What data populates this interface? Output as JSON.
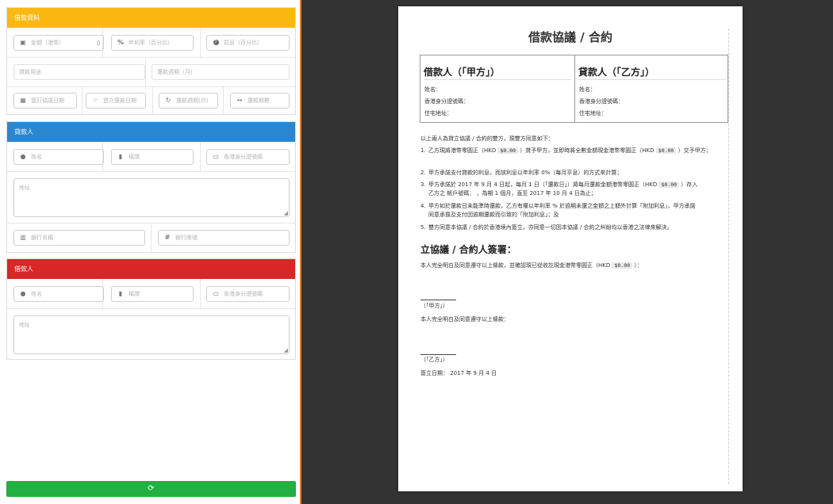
{
  "colors": {
    "loan_header": "#fbb810",
    "lender_header": "#2a87cf",
    "borrower_header": "#d92626",
    "refresh_button": "#22b040",
    "left_border": "#e07a2a",
    "background": "#333333"
  },
  "loan_panel": {
    "title": "借款資料",
    "row1": [
      {
        "icon": "money-icon",
        "glyph": "💵",
        "placeholder": "金額（港幣）",
        "suffix": "$"
      },
      {
        "icon": "percent-icon",
        "glyph": "%",
        "placeholder": "年利率（百分比）"
      },
      {
        "icon": "question-icon",
        "glyph": "?",
        "placeholder": "罰息（百分比）"
      }
    ],
    "row2": [
      {
        "placeholder": "貸款用途"
      },
      {
        "placeholder": "還款週期（月）"
      }
    ],
    "row3": [
      {
        "icon": "calendar-icon",
        "glyph": "📅",
        "placeholder": "簽訂協議日期"
      },
      {
        "icon": "hand-icon",
        "glyph": "☞",
        "placeholder": "首次還款日期"
      },
      {
        "icon": "repeat-icon",
        "glyph": "↻",
        "placeholder": "還款週期(月)"
      },
      {
        "icon": "arrows-icon",
        "glyph": "↔",
        "placeholder": "還款期數"
      }
    ]
  },
  "lender_panel": {
    "title": "貸款人",
    "row1": [
      {
        "icon": "user-icon",
        "glyph": "👤",
        "placeholder": "姓名"
      },
      {
        "icon": "id-badge-icon",
        "glyph": "▮",
        "placeholder": "稱謂"
      },
      {
        "icon": "id-card-icon",
        "glyph": "▭",
        "placeholder": "香港身分證號碼"
      }
    ],
    "address_placeholder": "地址",
    "row3": [
      {
        "icon": "bank-icon",
        "glyph": "🏦",
        "placeholder": "銀行名稱"
      },
      {
        "icon": "hash-icon",
        "glyph": "#",
        "placeholder": "銀行賬號"
      }
    ]
  },
  "borrower_panel": {
    "title": "借款人",
    "row1": [
      {
        "icon": "user-icon",
        "glyph": "👤",
        "placeholder": "姓名"
      },
      {
        "icon": "id-badge-icon",
        "glyph": "▮",
        "placeholder": "稱謂"
      },
      {
        "icon": "id-card-icon",
        "glyph": "▭",
        "placeholder": "香港身分證號碼"
      }
    ],
    "address_placeholder": "地址"
  },
  "refresh_button": {
    "icon": "refresh-icon",
    "glyph": "⟳"
  },
  "document": {
    "title": "借款協議 / 合約",
    "borrower_col": {
      "heading": "借款人（「甲方」）",
      "name_label": "姓名：",
      "id_label": "香港身分證號碼：",
      "address_label": "住宅地址："
    },
    "lender_col": {
      "heading": "貸款人（「乙方」）",
      "name_label": "姓名：",
      "id_label": "香港身分證號碼：",
      "address_label": "住宅地址："
    },
    "intro": "以上兩人為貸立協議 / 合約的雙方，現雙方同意如下：",
    "clauses": [
      {
        "num": "1.",
        "pre": "乙方現將港幣零圓正（HKD",
        "amount": "$0.00",
        "mid": "）貸予甲方，並即時將全數金額現金港幣零圓正（HKD",
        "amount2": "$0.00",
        "post": "）交予甲方；",
        "line2": ""
      },
      {
        "num": "2.",
        "text": "甲方承諾支付貸款的利息，而該利息以年利率 0%（每月平息）的方式來計算；"
      },
      {
        "num": "3.",
        "pre": "甲方承諾於 2017 年 9 月 4 日起，每月 1 日（「還款日」）將每月還款金額港幣零圓正（HKD",
        "amount": "$0.00",
        "post": "）存入",
        "line2": "乙方之    帳戶號碼：    ，為期 1 個月，直至 2017 年 10 月 4 日為止；"
      },
      {
        "num": "4.",
        "text": "甲方如於還款日未能準時還款，乙方有權以年利率 % 於逾期未還之金額之上額外計算「附加利息」，甲方承諾",
        "line2": "同意承擔及支付因逾期還款而引致的「附加利息」；及"
      },
      {
        "num": "5.",
        "text": "雙方同意本協議 / 合約於香港境內簽立，亦同意一切因本協議 / 合約之糾紛均以香港之法律來解決。"
      }
    ],
    "sign_heading": "立協議 / 合約人簽署：",
    "borrower_declaration_pre": "本人完全明白及同意遵守以上條款，並確認現已從收訖現金港幣零圓正（HKD",
    "borrower_declaration_amount": "$0.00",
    "borrower_declaration_post": "）：",
    "party_a_label": "（「甲方」）",
    "lender_declaration": "本人完全明白及同意遵守以上條款：",
    "party_b_label": "（「乙方」）",
    "date_line": "簽立日期： 2017 年 9 月 4 日"
  }
}
